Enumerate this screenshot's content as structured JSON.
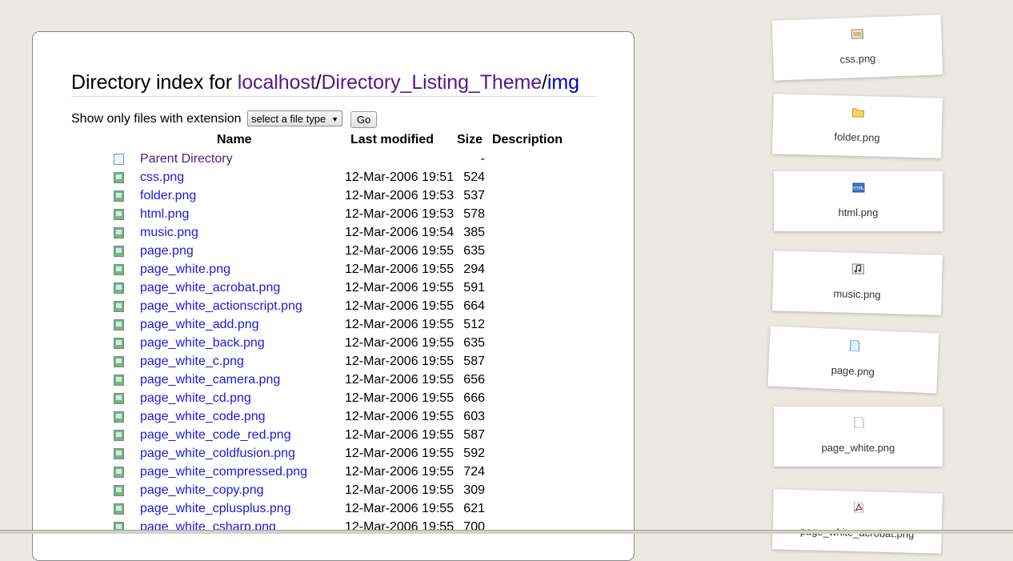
{
  "page": {
    "title_prefix": "Directory index for ",
    "crumb_host": "localhost",
    "crumb_sep1": "/",
    "crumb_theme": "Directory_Listing_Theme",
    "crumb_sep2": "/",
    "crumb_current": "img"
  },
  "filter": {
    "label": "Show only files with extension",
    "select_value": "select a file type",
    "go_label": "Go"
  },
  "columns": {
    "name": "Name",
    "last_modified": "Last modified",
    "size": "Size",
    "description": "Description"
  },
  "rows": [
    {
      "name": "Parent Directory",
      "date": "",
      "size": "-",
      "icon": "parent-page-icon"
    },
    {
      "name": "css.png",
      "date": "12-Mar-2006 19:51",
      "size": "524",
      "icon": "image-icon"
    },
    {
      "name": "folder.png",
      "date": "12-Mar-2006 19:53",
      "size": "537",
      "icon": "image-icon"
    },
    {
      "name": "html.png",
      "date": "12-Mar-2006 19:53",
      "size": "578",
      "icon": "image-icon"
    },
    {
      "name": "music.png",
      "date": "12-Mar-2006 19:54",
      "size": "385",
      "icon": "image-icon"
    },
    {
      "name": "page.png",
      "date": "12-Mar-2006 19:55",
      "size": "635",
      "icon": "image-icon"
    },
    {
      "name": "page_white.png",
      "date": "12-Mar-2006 19:55",
      "size": "294",
      "icon": "image-icon"
    },
    {
      "name": "page_white_acrobat.png",
      "date": "12-Mar-2006 19:55",
      "size": "591",
      "icon": "image-icon"
    },
    {
      "name": "page_white_actionscript.png",
      "date": "12-Mar-2006 19:55",
      "size": "664",
      "icon": "image-icon"
    },
    {
      "name": "page_white_add.png",
      "date": "12-Mar-2006 19:55",
      "size": "512",
      "icon": "image-icon"
    },
    {
      "name": "page_white_back.png",
      "date": "12-Mar-2006 19:55",
      "size": "635",
      "icon": "image-icon"
    },
    {
      "name": "page_white_c.png",
      "date": "12-Mar-2006 19:55",
      "size": "587",
      "icon": "image-icon"
    },
    {
      "name": "page_white_camera.png",
      "date": "12-Mar-2006 19:55",
      "size": "656",
      "icon": "image-icon"
    },
    {
      "name": "page_white_cd.png",
      "date": "12-Mar-2006 19:55",
      "size": "666",
      "icon": "image-icon"
    },
    {
      "name": "page_white_code.png",
      "date": "12-Mar-2006 19:55",
      "size": "603",
      "icon": "image-icon"
    },
    {
      "name": "page_white_code_red.png",
      "date": "12-Mar-2006 19:55",
      "size": "587",
      "icon": "image-icon"
    },
    {
      "name": "page_white_coldfusion.png",
      "date": "12-Mar-2006 19:55",
      "size": "592",
      "icon": "image-icon"
    },
    {
      "name": "page_white_compressed.png",
      "date": "12-Mar-2006 19:55",
      "size": "724",
      "icon": "image-icon"
    },
    {
      "name": "page_white_copy.png",
      "date": "12-Mar-2006 19:55",
      "size": "309",
      "icon": "image-icon"
    },
    {
      "name": "page_white_cplusplus.png",
      "date": "12-Mar-2006 19:55",
      "size": "621",
      "icon": "image-icon"
    },
    {
      "name": "page_white_csharp.png",
      "date": "12-Mar-2006 19:55",
      "size": "700",
      "icon": "image-icon"
    }
  ],
  "cards": [
    {
      "label": "css.png",
      "icon": "css-icon"
    },
    {
      "label": "folder.png",
      "icon": "folder-icon"
    },
    {
      "label": "html.png",
      "icon": "html-icon"
    },
    {
      "label": "music.png",
      "icon": "music-icon"
    },
    {
      "label": "page.png",
      "icon": "page-icon"
    },
    {
      "label": "page_white.png",
      "icon": "page-white-icon"
    },
    {
      "label": "page_white_acrobat.png",
      "icon": "acrobat-icon"
    }
  ],
  "colors": {
    "background": "#ece9e3",
    "link": "#1a1adb",
    "visited": "#551a8b"
  }
}
